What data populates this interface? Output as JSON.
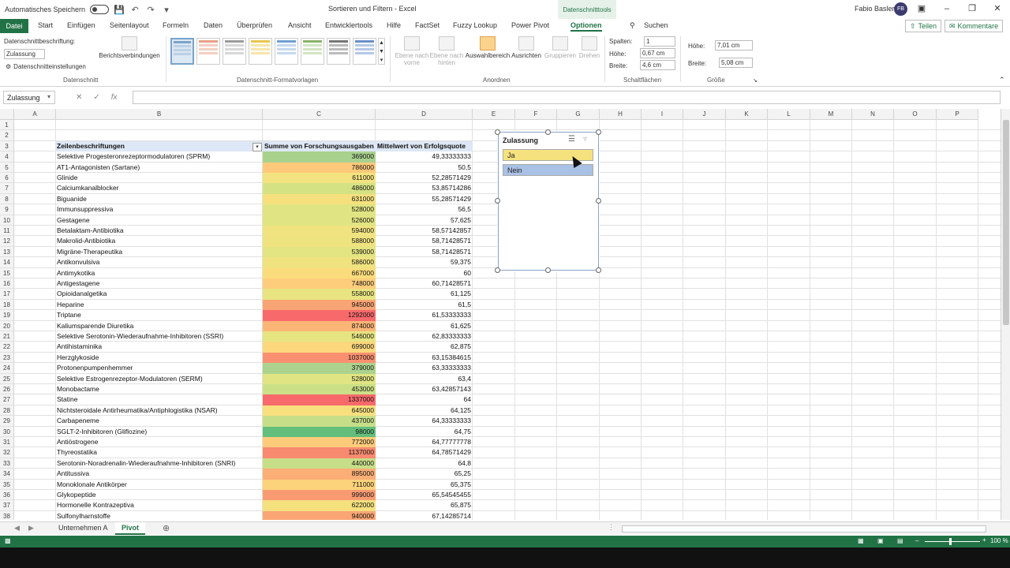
{
  "titlebar": {
    "autosave_label": "Automatisches Speichern",
    "title": "Sortieren und Filtern  -  Excel",
    "context_tab": "Datenschnitttools",
    "user": "Fabio Basler",
    "avatar_initials": "FB"
  },
  "menu": {
    "file": "Datei",
    "tabs": [
      "Start",
      "Einfügen",
      "Seitenlayout",
      "Formeln",
      "Daten",
      "Überprüfen",
      "Ansicht",
      "Entwicklertools",
      "Hilfe",
      "FactSet",
      "Fuzzy Lookup",
      "Power Pivot",
      "Optionen"
    ],
    "search": "Suchen",
    "share": "Teilen",
    "comments": "Kommentare"
  },
  "ribbon": {
    "caption_label": "Datenschnittbeschriftung:",
    "caption_value": "Zulassung",
    "settings": "Datenschnitteinstellungen",
    "report_connections": "Berichtsverbindungen",
    "group_slicer": "Datenschnitt",
    "group_styles": "Datenschnitt-Formatvorlagen",
    "bring_forward": "Ebene nach vorne",
    "send_backward": "Ebene nach hinten",
    "selection_pane": "Auswahlbereich",
    "align": "Ausrichten",
    "group": "Gruppieren",
    "rotate": "Drehen",
    "group_arrange": "Anordnen",
    "columns_label": "Spalten:",
    "columns_value": "1",
    "height_label": "Höhe:",
    "height_value": "0,67 cm",
    "width_label": "Breite:",
    "width_value": "4,6 cm",
    "group_buttons": "Schaltflächen",
    "size_height_label": "Höhe:",
    "size_height_value": "7,01 cm",
    "size_width_label": "Breite:",
    "size_width_value": "5,08 cm",
    "group_size": "Größe",
    "accent": "#217346"
  },
  "formula": {
    "namebox": "Zulassung",
    "fx": "fx",
    "content": ""
  },
  "columns": [
    "A",
    "B",
    "C",
    "D",
    "E",
    "F",
    "G",
    "H",
    "I",
    "J",
    "K",
    "L",
    "M",
    "N",
    "O",
    "P"
  ],
  "rows": [
    "1",
    "2",
    "3",
    "4",
    "5",
    "6",
    "7",
    "8",
    "9",
    "10",
    "11",
    "12",
    "13",
    "14",
    "15",
    "16",
    "17",
    "18",
    "19",
    "20",
    "21",
    "22",
    "23",
    "24",
    "25",
    "26",
    "27",
    "28",
    "29",
    "30",
    "31",
    "32",
    "33",
    "34",
    "35",
    "36",
    "37",
    "38"
  ],
  "table": {
    "headers": [
      "Zeilenbeschriftungen",
      "Summe von Forschungsausgaben",
      "Mittelwert von Erfolgsquote"
    ],
    "rows": [
      {
        "name": "Selektive Progesteronrezeptormodulatoren (SPRM)",
        "spend": "369000",
        "rate": "49,33333333",
        "color": "#a9d18e"
      },
      {
        "name": "AT1-Antagonisten (Sartane)",
        "spend": "786000",
        "rate": "50,5",
        "color": "#fec97a"
      },
      {
        "name": "Glinide",
        "spend": "611000",
        "rate": "52,28571429",
        "color": "#f3e380"
      },
      {
        "name": "Calciumkanalblocker",
        "spend": "486000",
        "rate": "53,85714286",
        "color": "#d5e283"
      },
      {
        "name": "Biguanide",
        "spend": "631000",
        "rate": "55,28571429",
        "color": "#f6e07e"
      },
      {
        "name": "Immunsuppressiva",
        "spend": "528000",
        "rate": "56,5",
        "color": "#e1e482"
      },
      {
        "name": "Gestagene",
        "spend": "526000",
        "rate": "57,625",
        "color": "#e1e482"
      },
      {
        "name": "Betalaktam-Antibiotika",
        "spend": "594000",
        "rate": "58,57142857",
        "color": "#f0e380"
      },
      {
        "name": "Makrolid-Antibiotika",
        "spend": "588000",
        "rate": "58,71428571",
        "color": "#efe380"
      },
      {
        "name": "Migräne-Therapeutika",
        "spend": "539000",
        "rate": "58,71428571",
        "color": "#e3e482"
      },
      {
        "name": "Antikonvulsiva",
        "spend": "586000",
        "rate": "59,375",
        "color": "#efe380"
      },
      {
        "name": "Antimykotika",
        "spend": "667000",
        "rate": "60",
        "color": "#fbdc7c"
      },
      {
        "name": "Antigestagene",
        "spend": "748000",
        "rate": "60,71428571",
        "color": "#fdcd7b"
      },
      {
        "name": "Opioidanalgetika",
        "spend": "558000",
        "rate": "61,125",
        "color": "#e8e481"
      },
      {
        "name": "Heparine",
        "spend": "945000",
        "rate": "61,5",
        "color": "#f9a474"
      },
      {
        "name": "Triptane",
        "spend": "1292000",
        "rate": "61,53333333",
        "color": "#f8696b"
      },
      {
        "name": "Kaliumsparende Diuretika",
        "spend": "874000",
        "rate": "61,625",
        "color": "#fbb577"
      },
      {
        "name": "Selektive Serotonin-Wiederaufnahme-Inhibitoren (SSRI)",
        "spend": "546000",
        "rate": "62,83333333",
        "color": "#e6e481"
      },
      {
        "name": "Antihistaminika",
        "spend": "699000",
        "rate": "62,875",
        "color": "#fcd77c"
      },
      {
        "name": "Herzglykoside",
        "spend": "1037000",
        "rate": "63,15384615",
        "color": "#f99070"
      },
      {
        "name": "Protonenpumpenhemmer",
        "spend": "379000",
        "rate": "63,33333333",
        "color": "#acd28e"
      },
      {
        "name": "Selektive Estrogenrezeptor-Modulatoren (SERM)",
        "spend": "528000",
        "rate": "63,4",
        "color": "#e1e482"
      },
      {
        "name": "Monobactame",
        "spend": "453000",
        "rate": "63,42857143",
        "color": "#cbe086"
      },
      {
        "name": "Statine",
        "spend": "1337000",
        "rate": "64",
        "color": "#f8696b"
      },
      {
        "name": "Nichtsteroidale Antirheumatika/Antiphlogistika (NSAR)",
        "spend": "645000",
        "rate": "64,125",
        "color": "#f7df7e"
      },
      {
        "name": "Carbapeneme",
        "spend": "437000",
        "rate": "64,33333333",
        "color": "#c6de88"
      },
      {
        "name": "SGLT-2-Inhibitoren (Gliflozine)",
        "spend": "98000",
        "rate": "64,75",
        "color": "#63be7b"
      },
      {
        "name": "Antiöstrogene",
        "spend": "772000",
        "rate": "64,77777778",
        "color": "#fdcb7a"
      },
      {
        "name": "Thyreostatika",
        "spend": "1137000",
        "rate": "64,78571429",
        "color": "#f88a6f"
      },
      {
        "name": "Serotonin-Noradrenalin-Wiederaufnahme-Inhibitoren (SNRI)",
        "spend": "440000",
        "rate": "64,8",
        "color": "#c7de88"
      },
      {
        "name": "Antitussiva",
        "spend": "895000",
        "rate": "65,25",
        "color": "#fbae76"
      },
      {
        "name": "Monoklonale Antikörper",
        "spend": "711000",
        "rate": "65,375",
        "color": "#fcd27b"
      },
      {
        "name": "Glykopeptide",
        "spend": "999000",
        "rate": "65,54545455",
        "color": "#f99b72"
      },
      {
        "name": "Hormonelle Kontrazeptiva",
        "spend": "622000",
        "rate": "65,875",
        "color": "#f5e07e"
      },
      {
        "name": "Sulfonylharnstoffe",
        "spend": "940000",
        "rate": "67,14285714",
        "color": "#faa574"
      }
    ]
  },
  "slicer": {
    "title": "Zulassung",
    "items": [
      {
        "label": "Ja",
        "selected": true,
        "color": "#f5e27e"
      },
      {
        "label": "Nein",
        "selected": false,
        "color": "#a9c1e4"
      }
    ]
  },
  "sheets": {
    "tabs": [
      "Unternehmen A",
      "Pivot"
    ],
    "active": "Pivot"
  },
  "status": {
    "zoom": "100 %"
  }
}
